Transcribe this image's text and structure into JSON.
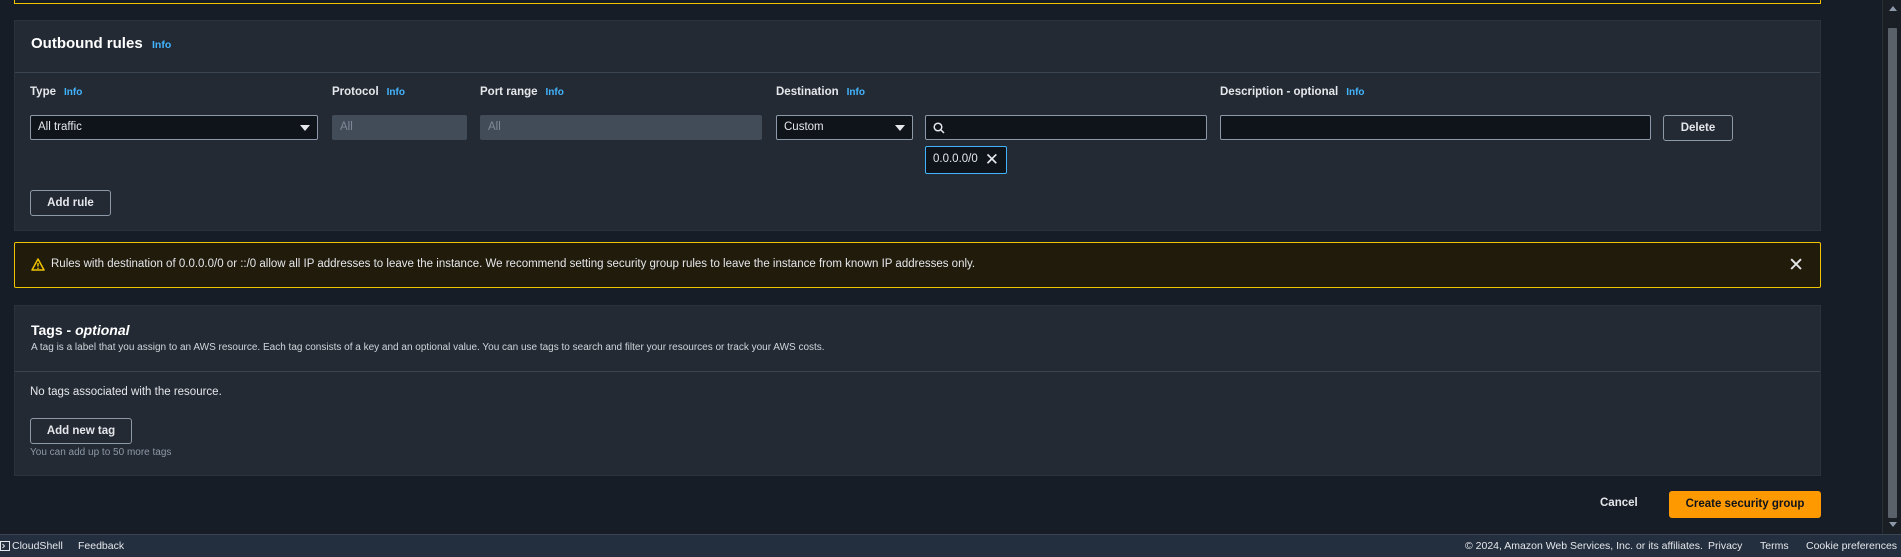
{
  "outbound": {
    "title": "Outbound rules",
    "info": "Info",
    "columns": {
      "type": "Type",
      "protocol": "Protocol",
      "port_range": "Port range",
      "destination": "Destination",
      "description": "Description - optional"
    },
    "rule": {
      "type": "All traffic",
      "protocol_placeholder": "All",
      "port_placeholder": "All",
      "destination_mode": "Custom",
      "destination_search": "",
      "destination_token": "0.0.0.0/0",
      "description": ""
    },
    "delete_label": "Delete",
    "add_rule_label": "Add rule"
  },
  "warning": {
    "text": "Rules with destination of 0.0.0.0/0 or ::/0 allow all IP addresses to leave the instance. We recommend setting security group rules to leave the instance from known IP addresses only."
  },
  "tags": {
    "title_main": "Tags - ",
    "title_optional": "optional",
    "description": "A tag is a label that you assign to an AWS resource. Each tag consists of a key and an optional value. You can use tags to search and filter your resources or track your AWS costs.",
    "empty": "No tags associated with the resource.",
    "add_label": "Add new tag",
    "limit_hint": "You can add up to 50 more tags"
  },
  "actions": {
    "cancel": "Cancel",
    "create": "Create security group"
  },
  "footer": {
    "cloudshell": "CloudShell",
    "feedback": "Feedback",
    "copyright": "© 2024, Amazon Web Services, Inc. or its affiliates.",
    "privacy": "Privacy",
    "terms": "Terms",
    "cookies": "Cookie preferences"
  },
  "colors": {
    "accent": "#42b4ff",
    "primary": "#ff9900",
    "warning": "#f0c400"
  }
}
